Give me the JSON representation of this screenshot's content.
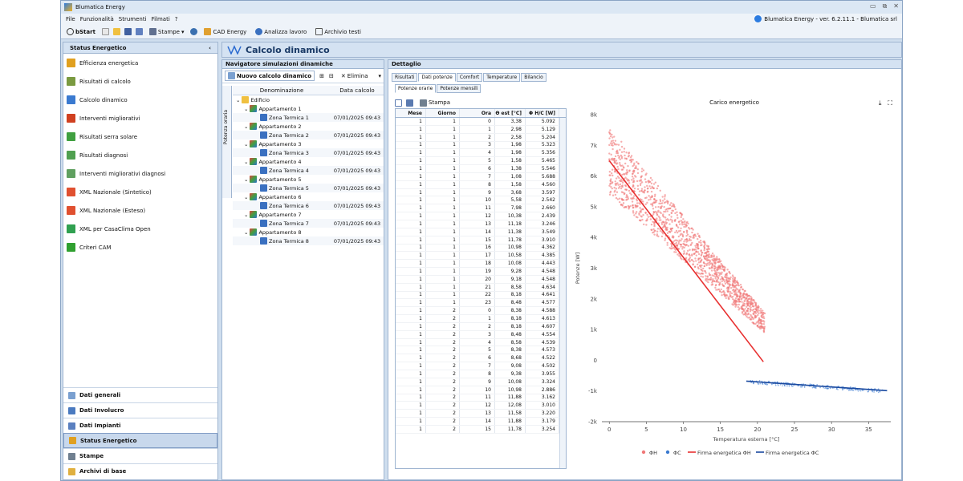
{
  "app": {
    "title": "Blumatica Energy",
    "version": "Blumatica Energy - ver. 6.2.11.1 - Blumatica srl"
  },
  "menu": [
    "File",
    "Funzionalità",
    "Strumenti",
    "Filmati",
    "?"
  ],
  "toolbar": {
    "start": "bStart",
    "stampe": "Stampe",
    "cad": "CAD Energy",
    "analizza": "Analizza lavoro",
    "archivio": "Archivio testi"
  },
  "sidebar": {
    "title": "Status Energetico",
    "collapse": "‹",
    "items": [
      {
        "label": "Efficienza energetica",
        "color": "#e0a020"
      },
      {
        "label": "Risultati di calcolo",
        "color": "#7a9a40"
      },
      {
        "label": "Calcolo dinamico",
        "color": "#3a7ad0"
      },
      {
        "label": "Interventi migliorativi",
        "color": "#d04020"
      },
      {
        "label": "Risultati serra solare",
        "color": "#40a040"
      },
      {
        "label": "Risultati diagnosi",
        "color": "#50a050"
      },
      {
        "label": "Interventi migliorativi diagnosi",
        "color": "#60a060"
      },
      {
        "label": "XML Nazionale (Sintetico)",
        "color": "#e05030"
      },
      {
        "label": "XML Nazionale (Esteso)",
        "color": "#e05030"
      },
      {
        "label": "XML per CasaClima Open",
        "color": "#30a050"
      },
      {
        "label": "Criteri CAM",
        "color": "#30a030"
      }
    ],
    "bottom": [
      "Dati generali",
      "Dati Involucro",
      "Dati Impianti",
      "Status Energetico",
      "Stampe",
      "Archivi di base"
    ]
  },
  "main_title": "Calcolo dinamico",
  "navigator": {
    "title": "Navigatore simulazioni dinamiche",
    "new_btn": "Nuovo calcolo dinamico",
    "delete_btn": "Elimina",
    "vtab": "Potenza oraria",
    "col1": "Denominazione",
    "col2": "Data calcolo",
    "root": "Edificio",
    "apartments": [
      {
        "name": "Appartamento 1",
        "zone": "Zona Termica 1",
        "date": "07/01/2025 09:43"
      },
      {
        "name": "Appartamento 2",
        "zone": "Zona Termica 2",
        "date": "07/01/2025 09:43"
      },
      {
        "name": "Appartamento 3",
        "zone": "Zona Termica 3",
        "date": "07/01/2025 09:43"
      },
      {
        "name": "Appartamento 4",
        "zone": "Zona Termica 4",
        "date": "07/01/2025 09:43"
      },
      {
        "name": "Appartamento 5",
        "zone": "Zona Termica 5",
        "date": "07/01/2025 09:43"
      },
      {
        "name": "Appartamento 6",
        "zone": "Zona Termica 6",
        "date": "07/01/2025 09:43"
      },
      {
        "name": "Appartamento 7",
        "zone": "Zona Termica 7",
        "date": "07/01/2025 09:43"
      },
      {
        "name": "Appartamento 8",
        "zone": "Zona Termica 8",
        "date": "07/01/2025 09:43"
      }
    ]
  },
  "detail": {
    "title": "Dettaglio",
    "tabs": [
      "Risultati",
      "Dati potenze",
      "Comfort",
      "Temperature",
      "Bilancio"
    ],
    "subtabs": [
      "Potenze orarie",
      "Potenze mensili"
    ],
    "print": "Stampa",
    "columns": [
      "Mese",
      "Giorno",
      "Ora",
      "Θ est [°C]",
      "Φ H/C [W]"
    ],
    "rows": [
      [
        1,
        1,
        0,
        "3,38",
        "5.092"
      ],
      [
        1,
        1,
        1,
        "2,98",
        "5.129"
      ],
      [
        1,
        1,
        2,
        "2,58",
        "5.204"
      ],
      [
        1,
        1,
        3,
        "1,98",
        "5.323"
      ],
      [
        1,
        1,
        4,
        "1,98",
        "5.356"
      ],
      [
        1,
        1,
        5,
        "1,58",
        "5.465"
      ],
      [
        1,
        1,
        6,
        "1,38",
        "5.546"
      ],
      [
        1,
        1,
        7,
        "1,08",
        "5.688"
      ],
      [
        1,
        1,
        8,
        "1,58",
        "4.560"
      ],
      [
        1,
        1,
        9,
        "3,68",
        "3.597"
      ],
      [
        1,
        1,
        10,
        "5,58",
        "2.542"
      ],
      [
        1,
        1,
        11,
        "7,98",
        "2.660"
      ],
      [
        1,
        1,
        12,
        "10,38",
        "2.439"
      ],
      [
        1,
        1,
        13,
        "11,18",
        "3.246"
      ],
      [
        1,
        1,
        14,
        "11,38",
        "3.549"
      ],
      [
        1,
        1,
        15,
        "11,78",
        "3.910"
      ],
      [
        1,
        1,
        16,
        "10,98",
        "4.362"
      ],
      [
        1,
        1,
        17,
        "10,58",
        "4.385"
      ],
      [
        1,
        1,
        18,
        "10,08",
        "4.443"
      ],
      [
        1,
        1,
        19,
        "9,28",
        "4.548"
      ],
      [
        1,
        1,
        20,
        "9,18",
        "4.548"
      ],
      [
        1,
        1,
        21,
        "8,58",
        "4.634"
      ],
      [
        1,
        1,
        22,
        "8,18",
        "4.641"
      ],
      [
        1,
        1,
        23,
        "8,48",
        "4.577"
      ],
      [
        1,
        2,
        0,
        "8,38",
        "4.588"
      ],
      [
        1,
        2,
        1,
        "8,18",
        "4.613"
      ],
      [
        1,
        2,
        2,
        "8,18",
        "4.607"
      ],
      [
        1,
        2,
        3,
        "8,48",
        "4.554"
      ],
      [
        1,
        2,
        4,
        "8,58",
        "4.539"
      ],
      [
        1,
        2,
        5,
        "8,38",
        "4.573"
      ],
      [
        1,
        2,
        6,
        "8,68",
        "4.522"
      ],
      [
        1,
        2,
        7,
        "9,08",
        "4.502"
      ],
      [
        1,
        2,
        8,
        "9,38",
        "3.955"
      ],
      [
        1,
        2,
        9,
        "10,08",
        "3.324"
      ],
      [
        1,
        2,
        10,
        "10,98",
        "2.886"
      ],
      [
        1,
        2,
        11,
        "11,88",
        "3.162"
      ],
      [
        1,
        2,
        12,
        "12,08",
        "3.010"
      ],
      [
        1,
        2,
        13,
        "11,58",
        "3.220"
      ],
      [
        1,
        2,
        14,
        "11,88",
        "3.179"
      ],
      [
        1,
        2,
        15,
        "11,78",
        "3.254"
      ]
    ]
  },
  "chart_data": {
    "type": "scatter",
    "title": "Carico energetico",
    "xlabel": "Temperatura esterna [°C]",
    "ylabel": "Potenze [W]",
    "xlim": [
      -1,
      38
    ],
    "ylim": [
      -2000,
      8000
    ],
    "xticks": [
      0,
      5,
      10,
      15,
      20,
      25,
      30,
      35
    ],
    "yticks": [
      -2000,
      -1000,
      0,
      1000,
      2000,
      3000,
      4000,
      5000,
      6000,
      7000,
      8000
    ],
    "ytick_labels": [
      "-2k",
      "-1k",
      "0",
      "1k",
      "2k",
      "3k",
      "4k",
      "5k",
      "6k",
      "7k",
      "8k"
    ],
    "series": [
      {
        "name": "ΦH",
        "kind": "scatter",
        "color": "#f07878",
        "trend": {
          "x": [
            0,
            21
          ],
          "y": [
            6500,
            1200
          ]
        }
      },
      {
        "name": "ΦC",
        "kind": "scatter",
        "color": "#3a7ad0",
        "trend": {
          "x": [
            19,
            37
          ],
          "y": [
            -700,
            -1000
          ]
        }
      },
      {
        "name": "Firma energetica ΦH",
        "kind": "line",
        "color": "#e83030",
        "x": [
          0,
          20.8
        ],
        "y": [
          6500,
          -50
        ]
      },
      {
        "name": "Firma energetica ΦC",
        "kind": "line",
        "color": "#1a4aa0",
        "x": [
          18.5,
          37.5
        ],
        "y": [
          -680,
          -990
        ]
      }
    ],
    "legend": "bottom"
  }
}
